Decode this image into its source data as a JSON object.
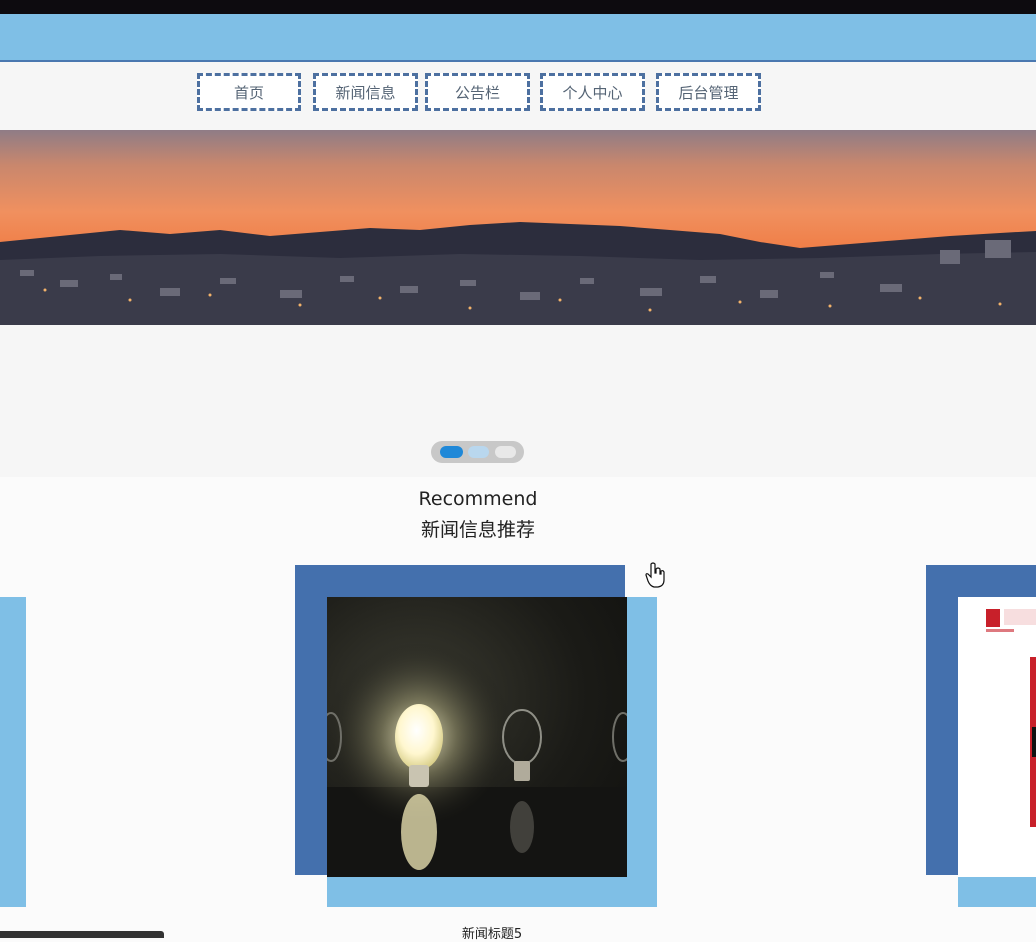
{
  "nav": {
    "items": [
      {
        "label": "首页"
      },
      {
        "label": "新闻信息"
      },
      {
        "label": "公告栏"
      },
      {
        "label": "个人中心"
      },
      {
        "label": "后台管理"
      }
    ]
  },
  "carousel": {
    "slide_count": 3,
    "active_index": 0
  },
  "recommend": {
    "title_en": "Recommend",
    "title_zh": "新闻信息推荐"
  },
  "news_cards": [
    {
      "title": "新闻标题5"
    }
  ],
  "colors": {
    "header_band": "#7fbfe6",
    "card_dark": "#4470ad",
    "card_light": "#7fbfe6",
    "nav_border": "#4d70a0",
    "dot_active": "#1f88d8"
  }
}
